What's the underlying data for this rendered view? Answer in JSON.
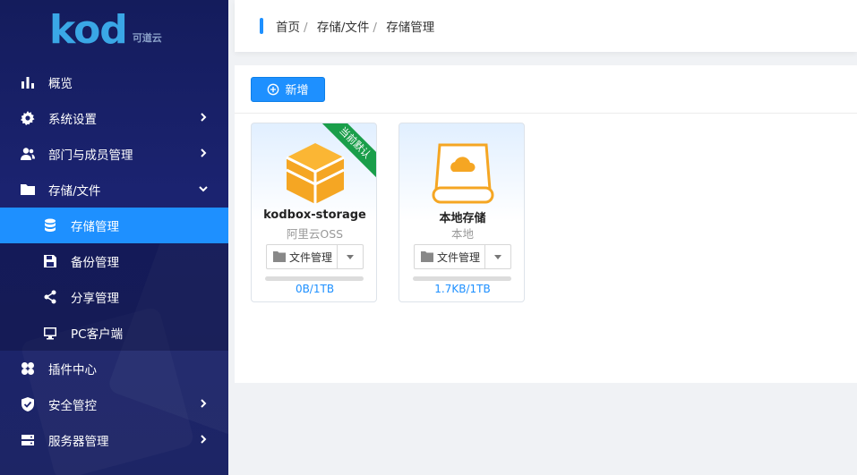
{
  "logo": {
    "brand": "kod",
    "sub": "可道云"
  },
  "menu": [
    {
      "label": "概览",
      "icon": "bar-chart-icon",
      "arrow": ""
    },
    {
      "label": "系统设置",
      "icon": "gear-icon",
      "arrow": "right"
    },
    {
      "label": "部门与成员管理",
      "icon": "users-icon",
      "arrow": "right"
    },
    {
      "label": "存储/文件",
      "icon": "folder-icon",
      "arrow": "down"
    }
  ],
  "submenu": [
    {
      "label": "存储管理",
      "icon": "database-icon",
      "active": true
    },
    {
      "label": "备份管理",
      "icon": "save-icon",
      "active": false
    },
    {
      "label": "分享管理",
      "icon": "share-icon",
      "active": false
    },
    {
      "label": "PC客户端",
      "icon": "monitor-icon",
      "active": false
    }
  ],
  "menu2": [
    {
      "label": "插件中心",
      "icon": "plugin-icon",
      "arrow": ""
    },
    {
      "label": "安全管控",
      "icon": "shield-icon",
      "arrow": "right"
    },
    {
      "label": "服务器管理",
      "icon": "server-icon",
      "arrow": "right"
    }
  ],
  "breadcrumb": [
    "首页",
    "存储/文件",
    "存储管理"
  ],
  "toolbar": {
    "add_label": "新增"
  },
  "cards": [
    {
      "name": "kodbox-storage",
      "type": "阿里云OSS",
      "button": "文件管理",
      "usage": "0B/1TB",
      "progress": 0,
      "badge": "当前默认"
    },
    {
      "name": "本地存储",
      "type": "本地",
      "button": "文件管理",
      "usage": "1.7KB/1TB",
      "progress": 0,
      "badge": ""
    }
  ],
  "colors": {
    "accent": "#1e90ff",
    "sidebar": "#1b2370",
    "badge": "#1a9e4a",
    "box": "#f5a623"
  }
}
